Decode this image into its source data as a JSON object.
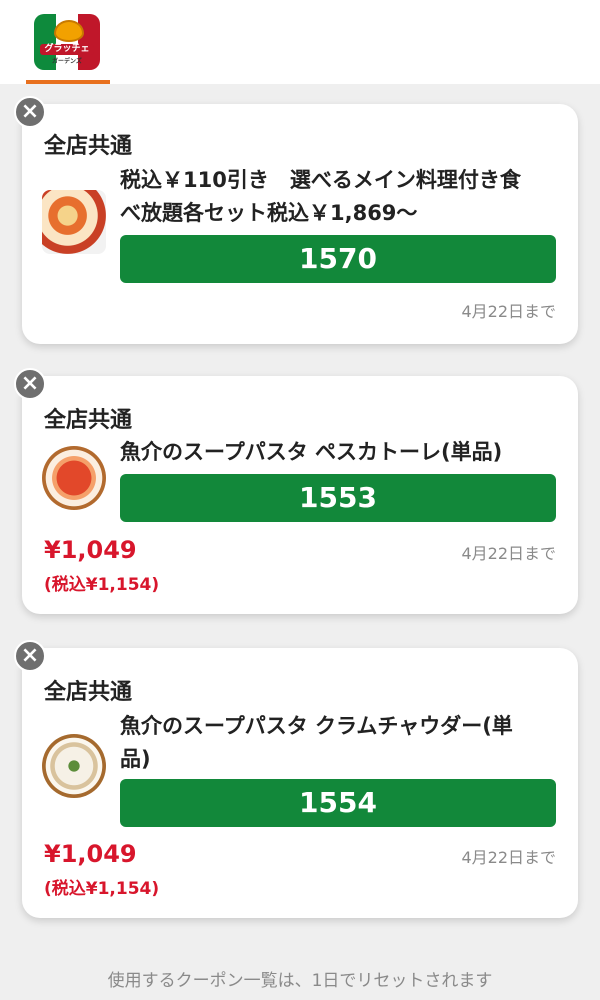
{
  "header": {
    "logo": {
      "tagline": "PASTA·PIZZA",
      "brand": "グラッチェ",
      "sub": "ガーデンズ",
      "colors": [
        "#0e8a3c",
        "#ffffff",
        "#c0172a"
      ]
    }
  },
  "coupons": [
    {
      "scope": "全店共通",
      "title": "税込￥110引き　選べるメイン料理付き食べ放題各セット税込￥1,869〜",
      "code": "1570",
      "expiry": "4月22日まで",
      "price": "",
      "tax_price": "",
      "image": "buffet-set-photo"
    },
    {
      "scope": "全店共通",
      "title": "魚介のスープパスタ ペスカトーレ(単品)",
      "code": "1553",
      "expiry": "4月22日まで",
      "price": "¥1,049",
      "tax_price": "(税込¥1,154)",
      "image": "pescatore-soup-pasta-photo"
    },
    {
      "scope": "全店共通",
      "title": "魚介のスープパスタ クラムチャウダー(単品)",
      "code": "1554",
      "expiry": "4月22日まで",
      "price": "¥1,049",
      "tax_price": "(税込¥1,154)",
      "image": "clam-chowder-soup-pasta-photo"
    }
  ],
  "footer": {
    "note": "使用するクーポン一覧は、1日でリセットされます"
  },
  "icons": {
    "close": "×"
  },
  "colors": {
    "code_button": "#12883a",
    "price": "#d8162c",
    "accent_underline": "#e8701e"
  }
}
